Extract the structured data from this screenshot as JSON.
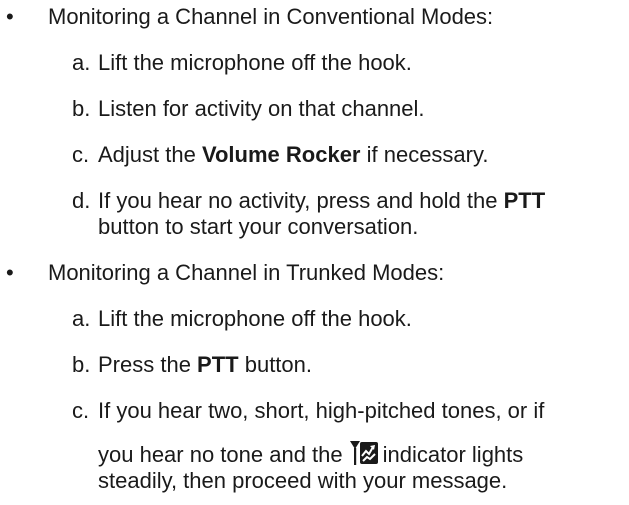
{
  "sections": [
    {
      "bullet": "•",
      "heading": "Monitoring a Channel in Conventional Modes:",
      "steps": [
        {
          "marker": "a.",
          "text": "Lift the microphone off the hook."
        },
        {
          "marker": "b.",
          "text": "Listen for activity on that channel."
        },
        {
          "marker": "c.",
          "pre": "Adjust the ",
          "bold": "Volume Rocker",
          "post": " if necessary."
        },
        {
          "marker": "d.",
          "pre": "If you hear no activity, press and hold the ",
          "bold": "PTT",
          "post": "",
          "cont": "button to start your conversation."
        }
      ]
    },
    {
      "bullet": "•",
      "heading": "Monitoring a Channel in Trunked Modes:",
      "steps": [
        {
          "marker": "a.",
          "text": "Lift the microphone off the hook."
        },
        {
          "marker": "b.",
          "pre": "Press the ",
          "bold": "PTT",
          "post": " button."
        },
        {
          "marker": "c.",
          "text": "If you hear two, short, high-pitched tones, or if",
          "cont_pre": "you hear no tone and the",
          "icon": "trunking-indicator-icon",
          "cont_post": "indicator lights",
          "cont2": "steadily, then proceed with your message."
        }
      ]
    }
  ]
}
